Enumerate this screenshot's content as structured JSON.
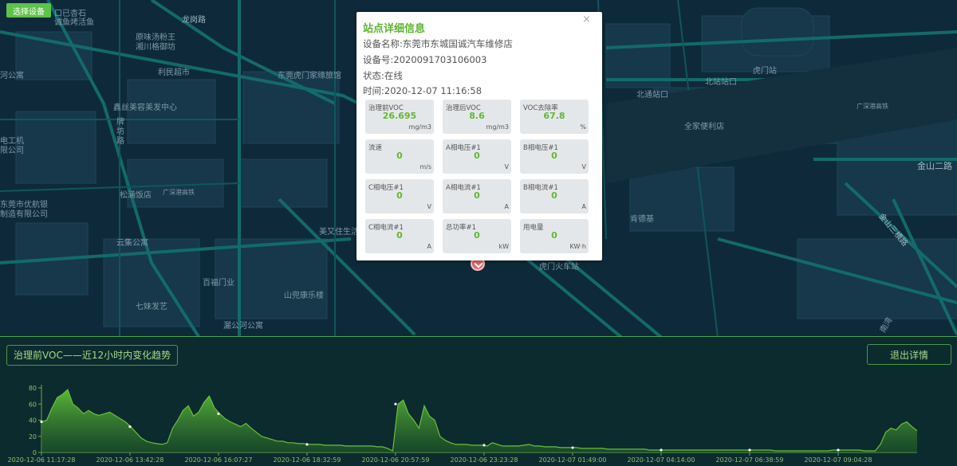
{
  "toolbar": {
    "select_device": "选择设备"
  },
  "map": {
    "labels": [
      {
        "text": "口已杏石"
      },
      {
        "text": "诚鱼烤活鱼"
      },
      {
        "text": "龙岗路"
      },
      {
        "text": "原味汤粉王"
      },
      {
        "text": "湘川格御坊"
      },
      {
        "text": "利民超市"
      },
      {
        "text": "鑫丝美容美发中心"
      },
      {
        "text": "牌"
      },
      {
        "text": "坊"
      },
      {
        "text": "路"
      },
      {
        "text": "松涵饭店"
      },
      {
        "text": "广深港高铁"
      },
      {
        "text": "云集公寓"
      },
      {
        "text": "百福门业"
      },
      {
        "text": "七妹发艺"
      },
      {
        "text": "漏公河公寓"
      },
      {
        "text": "山兜康乐楼"
      },
      {
        "text": "美又住生活"
      },
      {
        "text": "东莞虎门家缘旅馆"
      },
      {
        "text": "北站站口"
      },
      {
        "text": "虎门站"
      },
      {
        "text": "北通站口"
      },
      {
        "text": "全家便利店"
      },
      {
        "text": "广深港高铁"
      },
      {
        "text": "金山二路"
      },
      {
        "text": "金山三横路"
      },
      {
        "text": "肯德基"
      },
      {
        "text": "虎门火车站"
      },
      {
        "text": "河公寓"
      },
      {
        "text": "电工机"
      },
      {
        "text": "限公司"
      },
      {
        "text": "东莞市优航银"
      },
      {
        "text": "制造有限公司"
      },
      {
        "text": "南湾"
      }
    ]
  },
  "popup": {
    "close": "×",
    "title": "站点详细信息",
    "device_name": "设备名称:东莞市东城国诚汽车维修店",
    "device_no": "设备号:2020091703106003",
    "status": "状态:在线",
    "time": "时间:2020-12-07 11:16:58",
    "metrics": [
      {
        "label": "治理前VOC",
        "value": "26.695",
        "unit": "mg/m3"
      },
      {
        "label": "治理后VOC",
        "value": "8.6",
        "unit": "mg/m3"
      },
      {
        "label": "VOC去除率",
        "value": "67.8",
        "unit": "%"
      },
      {
        "label": "流速",
        "value": "0",
        "unit": "m/s"
      },
      {
        "label": "A相电压#1",
        "value": "0",
        "unit": "V"
      },
      {
        "label": "B相电压#1",
        "value": "0",
        "unit": "V"
      },
      {
        "label": "C相电压#1",
        "value": "0",
        "unit": "V"
      },
      {
        "label": "A相电流#1",
        "value": "0",
        "unit": "A"
      },
      {
        "label": "B相电流#1",
        "value": "0",
        "unit": "A"
      },
      {
        "label": "C相电流#1",
        "value": "0",
        "unit": "A"
      },
      {
        "label": "总功率#1",
        "value": "0",
        "unit": "kW"
      },
      {
        "label": "用电量",
        "value": "0",
        "unit": "KW·h"
      }
    ]
  },
  "panel": {
    "title": "治理前VOC——近12小时内变化趋势",
    "exit": "退出详情"
  },
  "chart_data": {
    "type": "area",
    "title": "治理前VOC——近12小时内变化趋势",
    "ylim": [
      0,
      80
    ],
    "yticks": [
      0,
      20,
      40,
      60,
      80
    ],
    "xticks": [
      "2020-12-06 11:17:28",
      "2020-12-06 13:42:28",
      "2020-12-06 16:07:27",
      "2020-12-06 18:32:59",
      "2020-12-06 20:57:59",
      "2020-12-06 23:23:28",
      "2020-12-07 01:49:00",
      "2020-12-07 04:14:00",
      "2020-12-07 06:38:59",
      "2020-12-07 09:04:28"
    ],
    "color": "#6abf3c",
    "series": [
      {
        "values": [
          38,
          40,
          55,
          68,
          72,
          78,
          60,
          55,
          48,
          52,
          48,
          46,
          48,
          50,
          46,
          42,
          38,
          32,
          25,
          18,
          14,
          12,
          11,
          10,
          12,
          30,
          40,
          52,
          58,
          45,
          50,
          62,
          70,
          55,
          48,
          42,
          38,
          35,
          32,
          36,
          30,
          25,
          20,
          18,
          16,
          14,
          14,
          12,
          12,
          11,
          11,
          10,
          10,
          10,
          9,
          9,
          9,
          9,
          8,
          8,
          8,
          8,
          8,
          8,
          7,
          7,
          5,
          2,
          60,
          65,
          48,
          40,
          30,
          58,
          45,
          40,
          20,
          15,
          12,
          10,
          10,
          10,
          9,
          9,
          9,
          8,
          12,
          10,
          8,
          8,
          8,
          8,
          9,
          10,
          8,
          8,
          7,
          7,
          7,
          6,
          6,
          6,
          6,
          5,
          5,
          5,
          5,
          5,
          4,
          4,
          4,
          4,
          4,
          4,
          4,
          4,
          3,
          3,
          3,
          3,
          3,
          3,
          3,
          3,
          3,
          3,
          3,
          3,
          3,
          3,
          3,
          3,
          3,
          3,
          3,
          3,
          3,
          3,
          3,
          3,
          2,
          2,
          2,
          2,
          2,
          2,
          2,
          2,
          2,
          2,
          2,
          3,
          3,
          3,
          3,
          3,
          3,
          2,
          2,
          2,
          10,
          25,
          30,
          28,
          35,
          38,
          32,
          27
        ]
      }
    ]
  }
}
